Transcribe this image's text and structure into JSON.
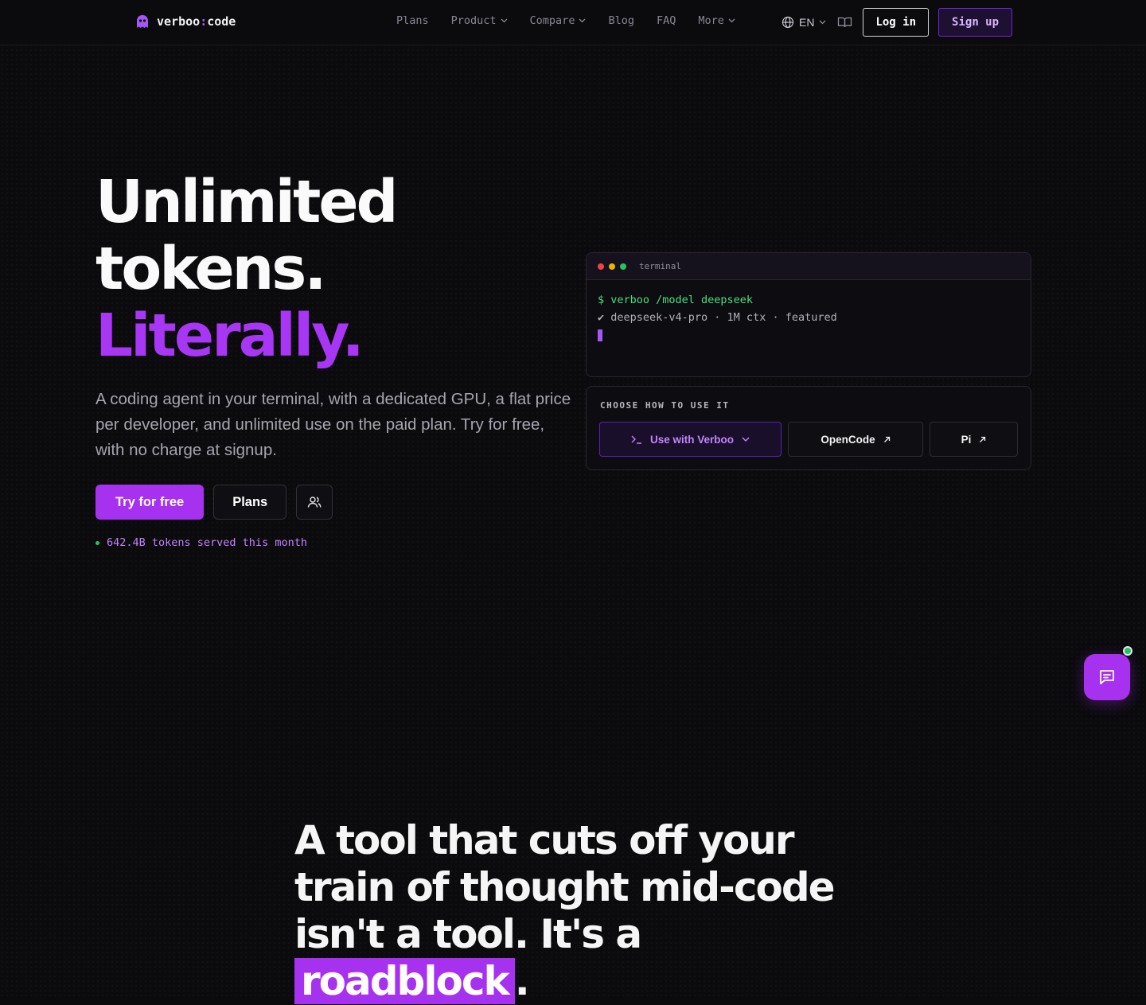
{
  "nav": {
    "logo_word": "verboo",
    "logo_sep": ":",
    "logo_suffix": "code",
    "links": [
      "Plans",
      "Product",
      "Compare",
      "Blog",
      "FAQ",
      "More"
    ],
    "lang": "EN",
    "login_label": "Log in",
    "signup_label": "Sign up"
  },
  "hero": {
    "title_line1": "Unlimited",
    "title_line2": "tokens.",
    "title_accent": "Literally.",
    "subtitle": "A coding agent in your terminal, with a dedicated GPU, a flat price per developer, and unlimited use on the paid plan. Try for free, with no charge at signup.",
    "try_label": "Try for free",
    "plans_label": "Plans",
    "tokens_stat": "642.4B tokens served this month"
  },
  "terminal": {
    "title": "terminal",
    "command": "$ verboo /model deepseek",
    "output": "✔ deepseek-v4-pro · 1M ctx · featured"
  },
  "choose": {
    "label": "CHOOSE HOW TO USE IT",
    "options": [
      "Use with Verboo",
      "OpenCode",
      "Pi"
    ]
  },
  "section2": {
    "text": "A tool that cuts off your train of thought mid-code isn't a tool. It's a",
    "highlight": "roadblock",
    "end": "."
  },
  "colors": {
    "accent": "#a632f0",
    "status_green": "#22c55e"
  }
}
